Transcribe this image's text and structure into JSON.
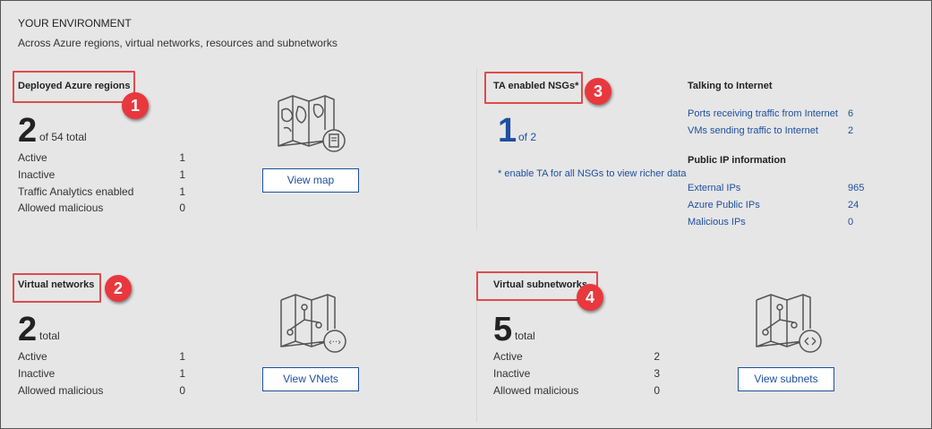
{
  "header": {
    "title": "YOUR ENVIRONMENT",
    "subtitle": "Across Azure regions, virtual networks, resources and subnetworks"
  },
  "regions": {
    "title": "Deployed Azure regions",
    "badge": "1",
    "count": "2",
    "count_suffix": "of 54 total",
    "rows": [
      {
        "label": "Active",
        "value": "1"
      },
      {
        "label": "Inactive",
        "value": "1"
      },
      {
        "label": "Traffic Analytics enabled",
        "value": "1"
      },
      {
        "label": "Allowed malicious",
        "value": "0"
      }
    ],
    "button": "View map",
    "icon": "map-document-icon"
  },
  "nsgs": {
    "title": "TA enabled NSGs*",
    "badge": "3",
    "count": "1",
    "count_suffix": "of 2",
    "note": "* enable TA for all NSGs to view richer data"
  },
  "internet": {
    "title": "Talking to Internet",
    "rows": [
      {
        "label": "Ports receiving traffic from Internet",
        "value": "6"
      },
      {
        "label": "VMs sending traffic to Internet",
        "value": "2"
      }
    ]
  },
  "public_ip": {
    "title": "Public IP information",
    "rows": [
      {
        "label": "External IPs",
        "value": "965"
      },
      {
        "label": "Azure Public IPs",
        "value": "24"
      },
      {
        "label": "Malicious IPs",
        "value": "0"
      }
    ]
  },
  "vnets": {
    "title": "Virtual networks",
    "badge": "2",
    "count": "2",
    "count_suffix": "total",
    "rows": [
      {
        "label": "Active",
        "value": "1"
      },
      {
        "label": "Inactive",
        "value": "1"
      },
      {
        "label": "Allowed malicious",
        "value": "0"
      }
    ],
    "button": "View VNets",
    "icon": "network-map-icon"
  },
  "subnets": {
    "title": "Virtual subnetworks",
    "badge": "4",
    "count": "5",
    "count_suffix": "total",
    "rows": [
      {
        "label": "Active",
        "value": "2"
      },
      {
        "label": "Inactive",
        "value": "3"
      },
      {
        "label": "Allowed malicious",
        "value": "0"
      }
    ],
    "button": "View subnets",
    "icon": "subnet-map-icon"
  },
  "colors": {
    "accent": "#1e4fa0",
    "highlight": "#e24a4a",
    "badge": "#e8383d",
    "background": "#e6e6e6"
  }
}
